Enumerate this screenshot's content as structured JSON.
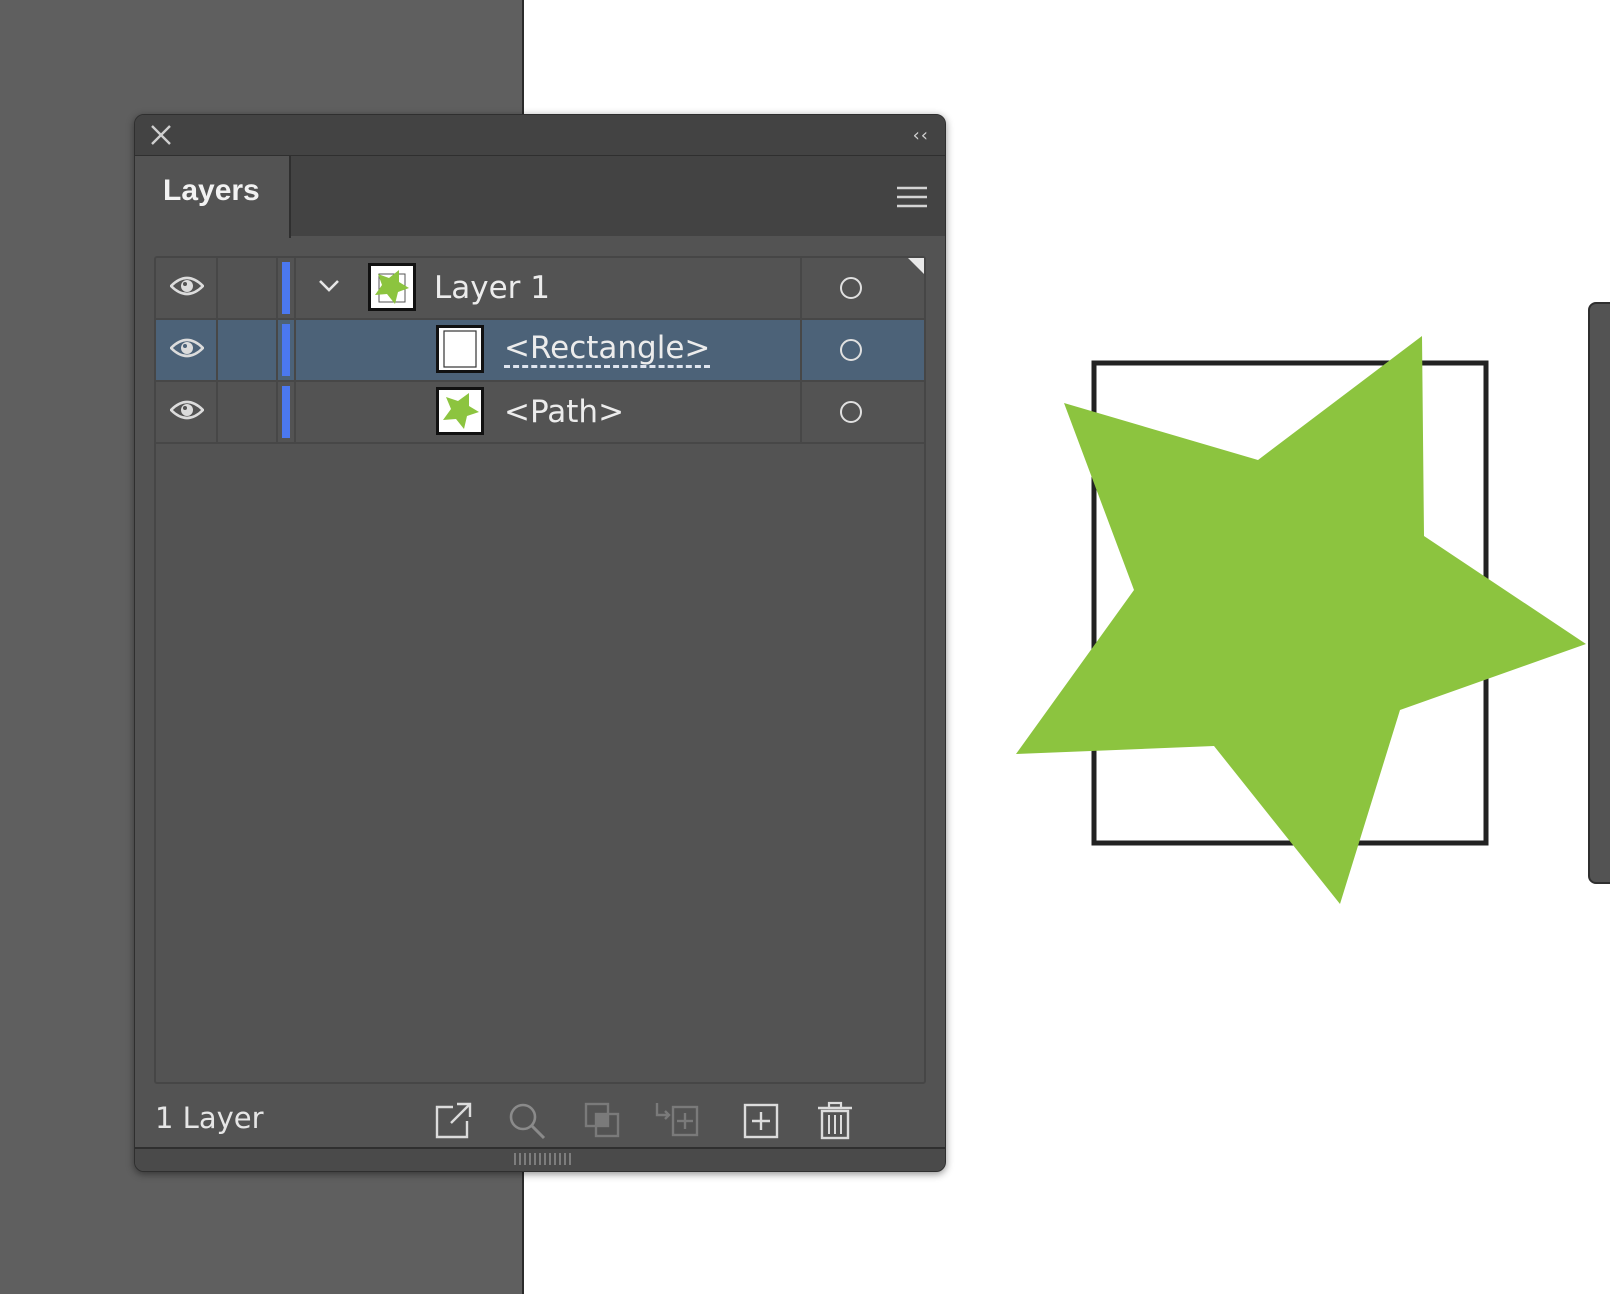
{
  "panel": {
    "tab_title": "Layers",
    "footer": {
      "layer_count_label": "1 Layer"
    }
  },
  "layers": [
    {
      "name": "Layer 1",
      "visible": true,
      "expanded": true,
      "selected": false,
      "thumbnail": "star-thumbnail"
    },
    {
      "name": "<Rectangle>",
      "visible": true,
      "selected": true,
      "thumbnail": "rectangle-thumbnail"
    },
    {
      "name": "<Path>",
      "visible": true,
      "selected": false,
      "thumbnail": "star-thumbnail"
    }
  ],
  "icons": {
    "close": "close-icon",
    "collapse": "collapse-double-chevron-icon",
    "menu": "panel-menu-icon",
    "visibility": "eye-icon",
    "expand": "chevron-down-icon",
    "target": "target-circle-icon",
    "footer": [
      "export-icon",
      "locate-object-search-icon",
      "make-clipping-mask-icon",
      "create-sublayer-icon",
      "create-new-layer-icon",
      "delete-trash-icon"
    ]
  },
  "colors": {
    "layer_color": "#4b78f0",
    "selection": "#4c6278",
    "star_fill": "#8cc43f",
    "panel_bg": "#535353"
  }
}
